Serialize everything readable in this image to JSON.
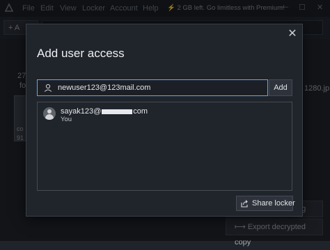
{
  "app": {
    "menu": [
      "File",
      "Edit",
      "View",
      "Locker",
      "Account",
      "Help"
    ],
    "promo": "2 GB left. Go limitless with Premium!",
    "toolbar_add": "A",
    "background_texts": [
      "27",
      "fo",
      "co",
      "91",
      "1280.jp"
    ],
    "side_buttons": [
      "ng",
      "Export decrypted copy"
    ]
  },
  "dialog": {
    "title": "Add user access",
    "email_input_value": "newuser123@123mail.com",
    "add_button": "Add",
    "users": [
      {
        "email_prefix": "sayak123@",
        "email_suffix": "com",
        "role": "You"
      }
    ],
    "share_button": "Share locker"
  },
  "colors": {
    "accent": "#6aa4e9",
    "dialog_bg": "#20242b",
    "app_bg": "#1f232a"
  }
}
